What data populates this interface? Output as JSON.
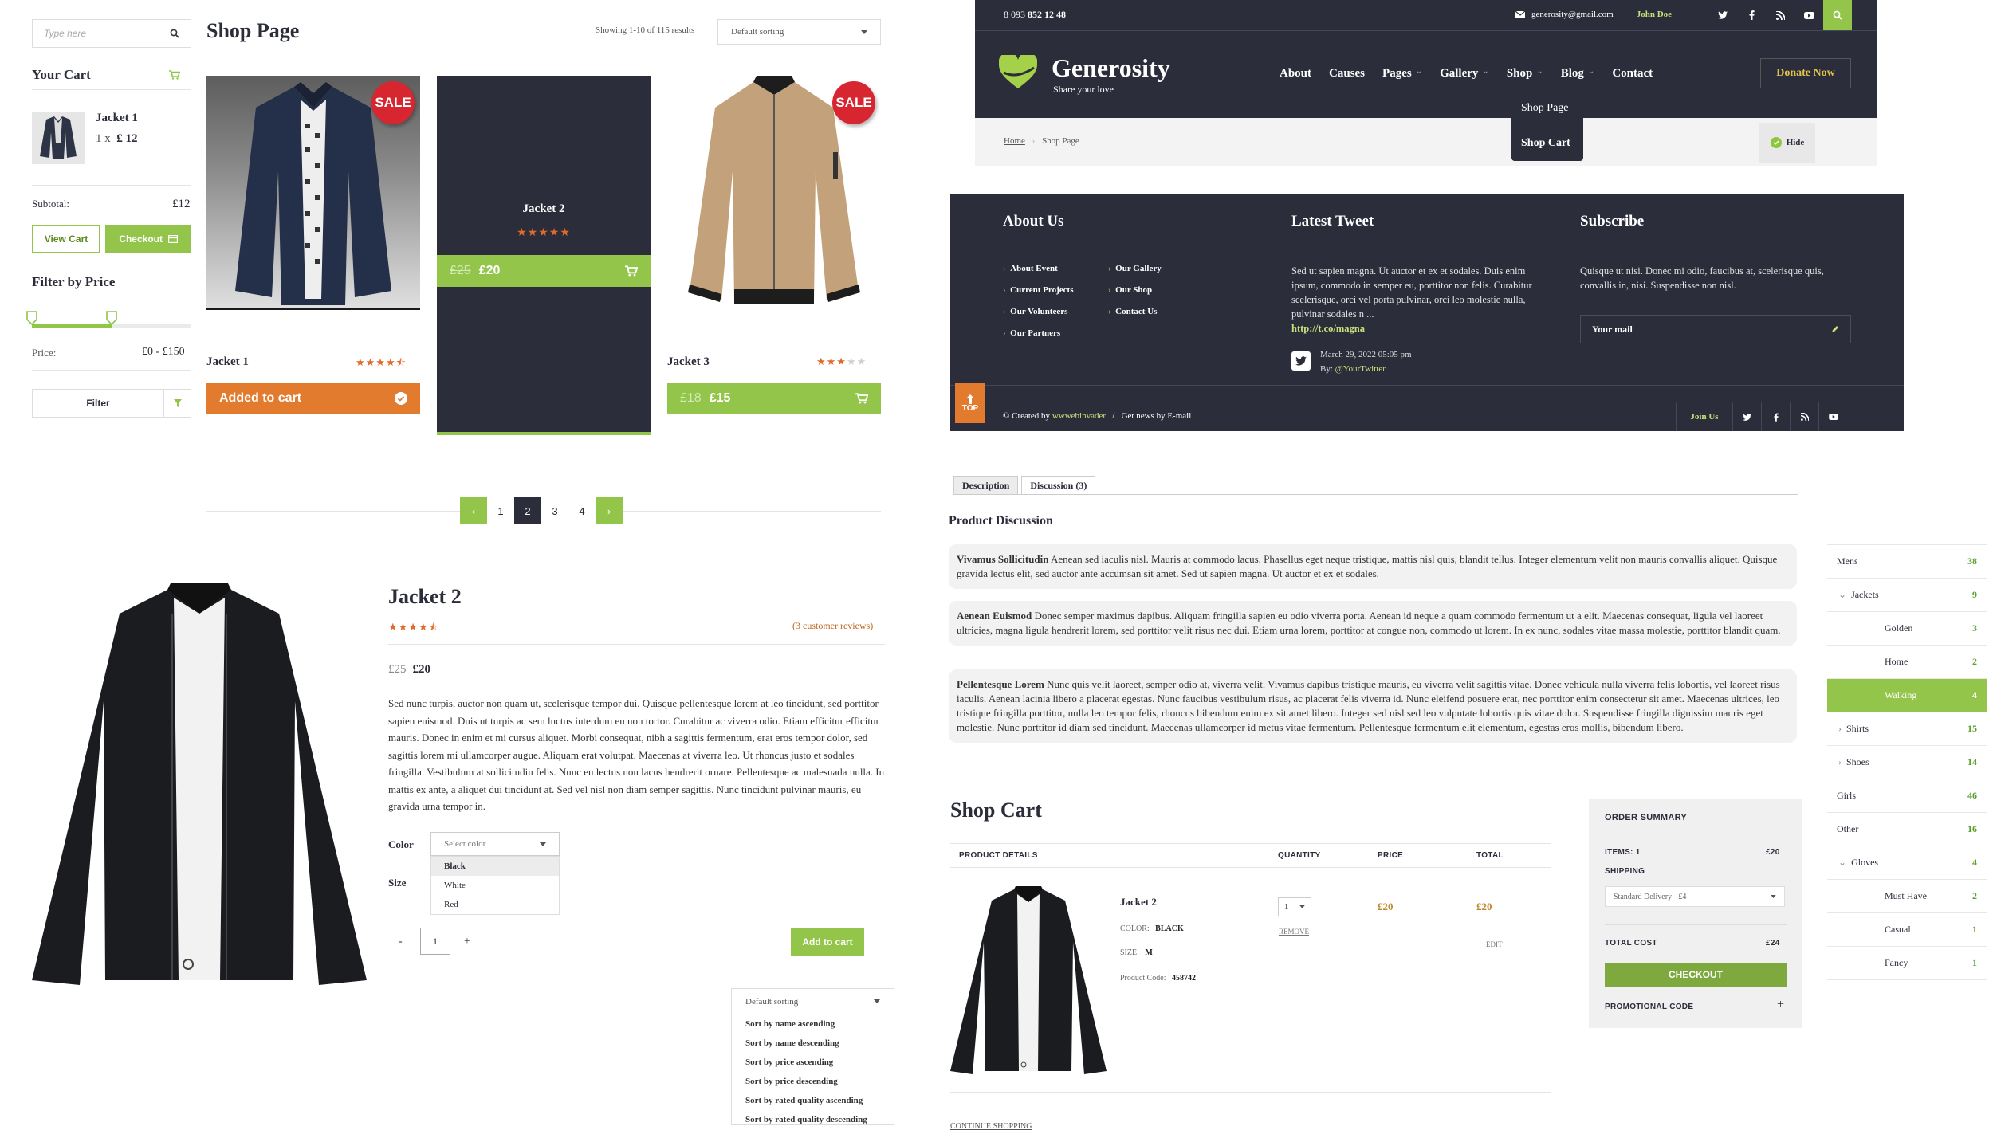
{
  "search": {
    "placeholder": "Type here"
  },
  "cart": {
    "title": "Your Cart",
    "item_name": "Jacket 1",
    "item_qty": "1 x",
    "item_price": "£ 12",
    "subtotal_label": "Subtotal:",
    "subtotal_value": "£12",
    "view_cart": "View Cart",
    "checkout": "Checkout"
  },
  "filter": {
    "title": "Filter by Price",
    "price_label": "Price:",
    "price_value": "£0 - £150",
    "button": "Filter",
    "range_min": 0,
    "range_max": 0.5
  },
  "shop": {
    "title": "Shop Page",
    "results": "Showing 1-10 of 115 results",
    "sorting": "Default sorting"
  },
  "products": [
    {
      "name": "Jacket 1",
      "sale": "SALE",
      "rating": 4.5,
      "button": "Added to cart",
      "stars": "★★★★",
      "half": "⯪"
    },
    {
      "name": "Jacket 2",
      "rating": 5,
      "old": "£25",
      "price": "£20",
      "stars": "★★★★★"
    },
    {
      "name": "Jacket 3",
      "sale": "SALE",
      "rating": 3,
      "old": "£18",
      "price": "£15",
      "stars": "★★★",
      "empty": "★★"
    }
  ],
  "pagination": {
    "pages": [
      "1",
      "2",
      "3",
      "4"
    ],
    "current": "2",
    "prev": "‹",
    "next": "›"
  },
  "product": {
    "name": "Jacket 2",
    "reviews": "(3 customer reviews)",
    "old": "£25",
    "price": "£20",
    "stars": "★★★★",
    "half": "⯪",
    "description": "Sed nunc turpis, auctor non quam ut, scelerisque tempor dui. Quisque pellentesque lorem at leo tincidunt, sed porttitor sapien euismod. Duis ut turpis ac sem luctus interdum eu non tortor. Curabitur ac viverra odio. Etiam efficitur efficitur mauris. Donec in enim et mi cursus aliquet. Morbi consequat, nibh a sagittis fermentum, erat eros tempor dolor, sed sagittis lorem mi ullamcorper augue. Aliquam erat volutpat. Maecenas at viverra leo. Ut rhoncus justo et sodales fringilla. Vestibulum at sollicitudin felis. Nunc eu lectus non lacus hendrerit ornare. Pellentesque ac malesuada nulla. In mattis ex ante, a aliquet dui tincidunt at. Sed vel nisl non diam semper sagittis. Nunc tincidunt pulvinar mauris, eu gravida urna tempor in.",
    "color_label": "Color",
    "color_placeholder": "Select color",
    "colors": [
      "Black",
      "White",
      "Red"
    ],
    "size_label": "Size",
    "qty": "1",
    "minus": "-",
    "plus": "+",
    "add": "Add to cart"
  },
  "sort_menu": {
    "selected": "Default sorting",
    "options": [
      "Sort by name ascending",
      "Sort by name descending",
      "Sort by price ascending",
      "Sort by price descending",
      "Sort by rated quality ascending",
      "Sort by rated quality descending"
    ]
  },
  "header": {
    "phone_prefix": "8 093",
    "phone": "852 12 48",
    "email": "generosity@gmail.com",
    "user": "John Doe",
    "logo": "Generosity",
    "tagline": "Share your love",
    "nav": [
      "About",
      "Causes",
      "Pages",
      "Gallery",
      "Shop",
      "Blog",
      "Contact"
    ],
    "donate": "Donate Now",
    "shop_menu": [
      "Shop Page",
      "Shop Cart"
    ],
    "breadcrumb_home": "Home",
    "breadcrumb_current": "Shop Page",
    "hide": "Hide"
  },
  "footer": {
    "about_title": "About Us",
    "links_col1": [
      "About Event",
      "Current Projects",
      "Our Volunteers",
      "Our Partners"
    ],
    "links_col2": [
      "Our Gallery",
      "Our Shop",
      "Contact Us"
    ],
    "tweet_title": "Latest Tweet",
    "tweet_text": "Sed ut sapien magna. Ut auctor et ex et sodales. Duis enim ipsum, commodo in semper eu, porttitor non felis. Curabitur scelerisque, orci vel porta pulvinar, orci leo molestie nulla, pulvinar sodales n ...",
    "tweet_link": "http://t.co/magna",
    "tweet_date": "March 29, 2022 05:05 pm",
    "tweet_by": "By:",
    "tweet_handle": "@YourTwitter",
    "subscribe_title": "Subscribe",
    "subscribe_text": "Quisque ut nisi. Donec mi odio, faucibus at, scelerisque quis, convallis in, nisi. Suspendisse non nisl.",
    "mail_placeholder": "Your mail",
    "created": "© Created by",
    "author": "wwwebinvader",
    "sep": "/",
    "news": "Get news by E-mail",
    "join": "Join Us",
    "top": "TOP"
  },
  "tabs": [
    "Description",
    "Discussion (3)"
  ],
  "discussion": {
    "title": "Product Discussion",
    "comments": [
      {
        "author": "Vivamus Sollicitudin",
        "text": "Aenean sed iaculis nisl. Mauris at commodo lacus. Phasellus eget neque tristique, mattis nisl quis, blandit tellus. Integer elementum velit non mauris convallis aliquet. Quisque gravida lectus elit, sed auctor ante accumsan sit amet. Sed ut sapien magna. Ut auctor et ex et sodales."
      },
      {
        "author": "Aenean Euismod",
        "text": "Donec semper maximus dapibus. Aliquam fringilla sapien eu odio viverra porta. Aenean id neque a quam commodo fermentum ut a elit. Maecenas consequat, ligula vel laoreet ultricies, magna ligula hendrerit lorem, sed porttitor velit risus nec dui. Etiam urna lorem, porttitor at congue non, commodo ut lorem. In ex nunc, sodales vitae massa molestie, porttitor blandit quam."
      },
      {
        "author": "Pellentesque Lorem",
        "text": "Nunc quis velit laoreet, semper odio at, viverra velit. Vivamus dapibus tristique mauris, eu viverra velit sagittis vitae. Donec vehicula nulla viverra felis lobortis, vel laoreet risus iaculis. Aenean lacinia libero a placerat egestas. Nunc faucibus vestibulum risus, ac placerat felis viverra id. Nunc eleifend posuere erat, nec porttitor enim consectetur sit amet. Maecenas ultrices, leo tristique fringilla porttitor, nulla leo tempor felis, rhoncus bibendum enim ex sit amet libero. Integer sed nisl sed leo vulputate lobortis quis vitae dolor. Suspendisse fringilla dignissim mauris eget molestie. Nunc porttitor id diam sed tincidunt. Maecenas ullamcorper id metus vitae fermentum. Pellentesque fermentum elit elementum, egestas eros mollis, bibendum libero."
      }
    ]
  },
  "categories": [
    {
      "name": "Mens",
      "count": "38",
      "level": 0
    },
    {
      "name": "Jackets",
      "count": "9",
      "level": 1,
      "arrow": "⌄"
    },
    {
      "name": "Golden",
      "count": "3",
      "level": 2
    },
    {
      "name": "Home",
      "count": "2",
      "level": 2
    },
    {
      "name": "Walking",
      "count": "4",
      "level": 2,
      "active": true
    },
    {
      "name": "Shirts",
      "count": "15",
      "level": 1,
      "arrow": "›"
    },
    {
      "name": "Shoes",
      "count": "14",
      "level": 1,
      "arrow": "›"
    },
    {
      "name": "Girls",
      "count": "46",
      "level": 0
    },
    {
      "name": "Other",
      "count": "16",
      "level": 0
    },
    {
      "name": "Gloves",
      "count": "4",
      "level": 1,
      "arrow": "⌄"
    },
    {
      "name": "Must Have",
      "count": "2",
      "level": 2
    },
    {
      "name": "Casual",
      "count": "1",
      "level": 2
    },
    {
      "name": "Fancy",
      "count": "1",
      "level": 2
    }
  ],
  "shopcart": {
    "title": "Shop Cart",
    "headers": [
      "PRODUCT DETAILS",
      "QUANTITY",
      "PRICE",
      "TOTAL"
    ],
    "item": "Jacket 2",
    "color_label": "COLOR:",
    "color": "BLACK",
    "size_label": "SIZE:",
    "size": "M",
    "code_label": "Product Code:",
    "code": "458742",
    "qty": "1",
    "remove": "REMOVE",
    "price": "£20",
    "total": "£20",
    "edit": "EDIT",
    "continue": "CONTINUE SHOPPING"
  },
  "summary": {
    "title": "ORDER SUMMARY",
    "items_label": "ITEMS: 1",
    "items_value": "£20",
    "shipping_label": "SHIPPING",
    "shipping_option": "Standard Delivery - £4",
    "total_label": "TOTAL COST",
    "total_value": "£24",
    "checkout": "CHECKOUT",
    "promo": "PROMOTIONAL CODE",
    "promo_icon": "+"
  },
  "colors": {
    "accent": "#93c54b",
    "dark": "#2b2d3a",
    "orange": "#e37b2e",
    "sale": "#d7262f"
  }
}
